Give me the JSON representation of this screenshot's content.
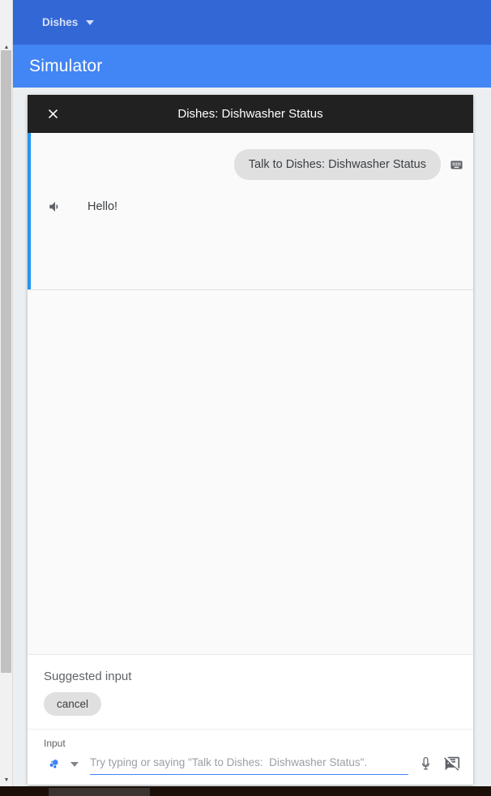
{
  "topbar": {
    "menu_label": "Dishes",
    "caret_icon": "chevron-down-icon",
    "bg_color": "#3367d6"
  },
  "simulator_bar": {
    "title": "Simulator",
    "bg_color": "#4285f4"
  },
  "dialog": {
    "close_icon": "close-icon",
    "title": "Dishes: Dishwasher Status",
    "header_bg": "#212121",
    "accent_color": "#2196f3"
  },
  "conversation": {
    "user_message": {
      "text": "Talk to Dishes: Dishwasher Status",
      "input_mode_icon": "keyboard-icon",
      "bubble_color": "#e0e0e0"
    },
    "agent_message": {
      "text": "Hello!",
      "audio_icon": "volume-up-icon"
    }
  },
  "suggestions": {
    "label": "Suggested input",
    "chips": [
      {
        "label": "cancel"
      }
    ]
  },
  "input": {
    "label": "Input",
    "placeholder": "Try typing or saying \"Talk to Dishes:  Dishwasher Status\".",
    "value": "",
    "assistant_icon": "assistant-dots-icon",
    "assistant_caret_icon": "chevron-down-icon",
    "mic_icon": "microphone-icon",
    "notes_off_icon": "speaker-notes-off-icon",
    "underline_color": "#4285f4"
  },
  "scrollbar": {
    "up_arrow_icon": "triangle-up-icon",
    "down_arrow_icon": "triangle-down-icon"
  }
}
